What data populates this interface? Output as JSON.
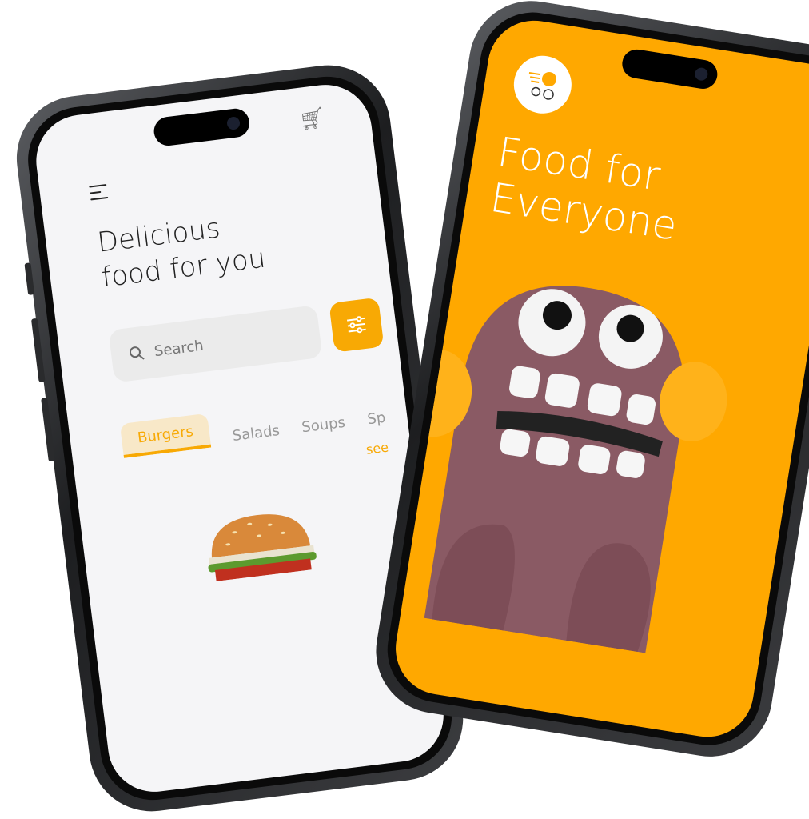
{
  "left_phone": {
    "title_line1": "Delicious",
    "title_line2": "food for you",
    "search_placeholder": "Search",
    "tabs": [
      {
        "label": "Burgers",
        "active": true
      },
      {
        "label": "Salads",
        "active": false
      },
      {
        "label": "Soups",
        "active": false
      },
      {
        "label": "Sp",
        "active": false
      }
    ],
    "see_more": "see",
    "icons": [
      "menu-icon",
      "cart-icon",
      "search-icon",
      "filter-icon"
    ]
  },
  "right_phone": {
    "headline_line1": "Food for",
    "headline_line2": "Everyone",
    "logo_icon": "delivery-chef-icon"
  },
  "colors": {
    "accent": "#f8a904",
    "orange_bg": "#ffa800",
    "monster": "#8a5a64"
  }
}
